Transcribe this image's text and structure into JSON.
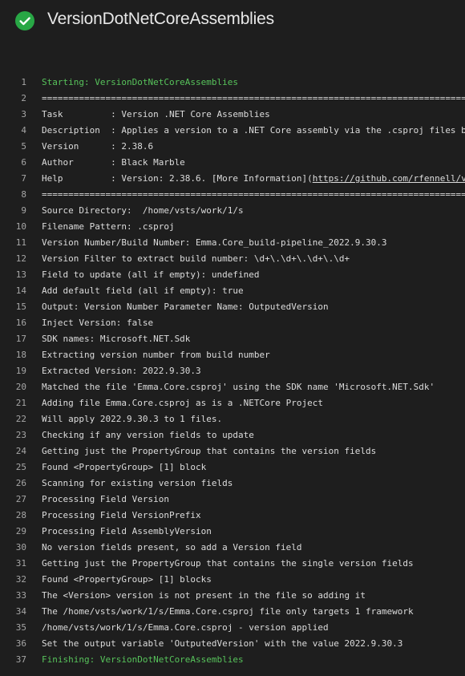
{
  "header": {
    "title": "VersionDotNetCoreAssemblies",
    "status": "succeeded",
    "status_color": "#28a745"
  },
  "log": {
    "lines": [
      {
        "n": "1",
        "text": "Starting: VersionDotNetCoreAssemblies",
        "style": "green"
      },
      {
        "n": "2",
        "text": "=================================================================================="
      },
      {
        "n": "3",
        "text": "Task         : Version .NET Core Assemblies"
      },
      {
        "n": "4",
        "text": "Description  : Applies a version to a .NET Core assembly via the .csproj files b"
      },
      {
        "n": "5",
        "text": "Version      : 2.38.6"
      },
      {
        "n": "6",
        "text": "Author       : Black Marble"
      },
      {
        "n": "7",
        "text": "Help         : Version: 2.38.6. [More Information](",
        "link": "https://github.com/rfennell/v"
      },
      {
        "n": "8",
        "text": "=================================================================================="
      },
      {
        "n": "9",
        "text": "Source Directory:  /home/vsts/work/1/s"
      },
      {
        "n": "10",
        "text": "Filename Pattern: .csproj"
      },
      {
        "n": "11",
        "text": "Version Number/Build Number: Emma.Core_build-pipeline_2022.9.30.3"
      },
      {
        "n": "12",
        "text": "Version Filter to extract build number: \\d+\\.\\d+\\.\\d+\\.\\d+"
      },
      {
        "n": "13",
        "text": "Field to update (all if empty): undefined"
      },
      {
        "n": "14",
        "text": "Add default field (all if empty): true"
      },
      {
        "n": "15",
        "text": "Output: Version Number Parameter Name: OutputedVersion"
      },
      {
        "n": "16",
        "text": "Inject Version: false"
      },
      {
        "n": "17",
        "text": "SDK names: Microsoft.NET.Sdk"
      },
      {
        "n": "18",
        "text": "Extracting version number from build number"
      },
      {
        "n": "19",
        "text": "Extracted Version: 2022.9.30.3"
      },
      {
        "n": "20",
        "text": "Matched the file 'Emma.Core.csproj' using the SDK name 'Microsoft.NET.Sdk'"
      },
      {
        "n": "21",
        "text": "Adding file Emma.Core.csproj as is a .NETCore Project"
      },
      {
        "n": "22",
        "text": "Will apply 2022.9.30.3 to 1 files."
      },
      {
        "n": "23",
        "text": "Checking if any version fields to update"
      },
      {
        "n": "24",
        "text": "Getting just the PropertyGroup that contains the version fields"
      },
      {
        "n": "25",
        "text": "Found <PropertyGroup> [1] block"
      },
      {
        "n": "26",
        "text": "Scanning for existing version fields"
      },
      {
        "n": "27",
        "text": "Processing Field Version"
      },
      {
        "n": "28",
        "text": "Processing Field VersionPrefix"
      },
      {
        "n": "29",
        "text": "Processing Field AssemblyVersion"
      },
      {
        "n": "30",
        "text": "No version fields present, so add a Version field"
      },
      {
        "n": "31",
        "text": "Getting just the PropertyGroup that contains the single version fields"
      },
      {
        "n": "32",
        "text": "Found <PropertyGroup> [1] blocks"
      },
      {
        "n": "33",
        "text": "The <Version> version is not present in the file so adding it"
      },
      {
        "n": "34",
        "text": "The /home/vsts/work/1/s/Emma.Core.csproj file only targets 1 framework"
      },
      {
        "n": "35",
        "text": "/home/vsts/work/1/s/Emma.Core.csproj - version applied"
      },
      {
        "n": "36",
        "text": "Set the output variable 'OutputedVersion' with the value 2022.9.30.3"
      },
      {
        "n": "37",
        "text": "Finishing: VersionDotNetCoreAssemblies",
        "style": "green"
      }
    ]
  }
}
